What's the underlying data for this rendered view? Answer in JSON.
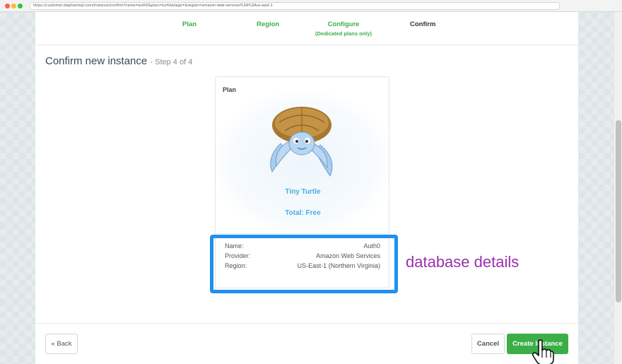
{
  "browser": {
    "url": "https://customer.elephantsql.com/instance/confirm?name=auth0&plan=turtle&tags=&region=amazon-web-services%3A%3Aus-east-1"
  },
  "steps": [
    {
      "label": "Plan",
      "state": "done"
    },
    {
      "label": "Region",
      "state": "done"
    },
    {
      "label": "Configure",
      "sub": "(Dedicated plans only)",
      "state": "done"
    },
    {
      "label": "Confirm",
      "state": "current"
    }
  ],
  "page": {
    "title": "Confirm new instance",
    "step_note": "- Step 4 of 4"
  },
  "plan": {
    "label": "Plan",
    "name": "Tiny Turtle",
    "total": "Total: Free",
    "image": "turtle-icon"
  },
  "details": [
    {
      "key": "Name:",
      "value": "Auth0"
    },
    {
      "key": "Provider:",
      "value": "Amazon Web Services"
    },
    {
      "key": "Region:",
      "value": "US-East-1 (Northern Virginia)"
    }
  ],
  "annotation": {
    "text": "database details",
    "color": "#9b2fae",
    "box_color": "#1e90f0"
  },
  "buttons": {
    "back": "« Back",
    "cancel": "Cancel",
    "create": "Create Instance"
  },
  "colors": {
    "accent_green": "#3cae48",
    "plan_blue": "#4aaee3"
  }
}
